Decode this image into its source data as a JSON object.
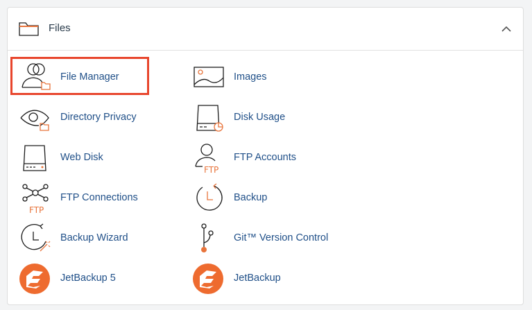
{
  "section": {
    "title": "Files",
    "header_icon": "folder-icon",
    "collapse_icon": "chevron-up-icon"
  },
  "colors": {
    "link": "#1f4f88",
    "icon_dark": "#1a1a1a",
    "icon_accent": "#e8743b",
    "highlight_border": "#e8452c",
    "jetbackup_orange": "#ee6b2f"
  },
  "items": [
    {
      "label": "File Manager",
      "icon": "file-manager-icon",
      "highlighted": true
    },
    {
      "label": "Images",
      "icon": "images-icon"
    },
    {
      "label": "Directory Privacy",
      "icon": "directory-privacy-icon"
    },
    {
      "label": "Disk Usage",
      "icon": "disk-usage-icon"
    },
    {
      "label": "Web Disk",
      "icon": "web-disk-icon"
    },
    {
      "label": "FTP Accounts",
      "icon": "ftp-accounts-icon"
    },
    {
      "label": "FTP Connections",
      "icon": "ftp-connections-icon"
    },
    {
      "label": "Backup",
      "icon": "backup-icon"
    },
    {
      "label": "Backup Wizard",
      "icon": "backup-wizard-icon"
    },
    {
      "label": "Git™ Version Control",
      "icon": "git-version-control-icon"
    },
    {
      "label": "JetBackup 5",
      "icon": "jetbackup-5-icon"
    },
    {
      "label": "JetBackup",
      "icon": "jetbackup-icon"
    }
  ],
  "icon_text": {
    "ftp": "FTP"
  }
}
